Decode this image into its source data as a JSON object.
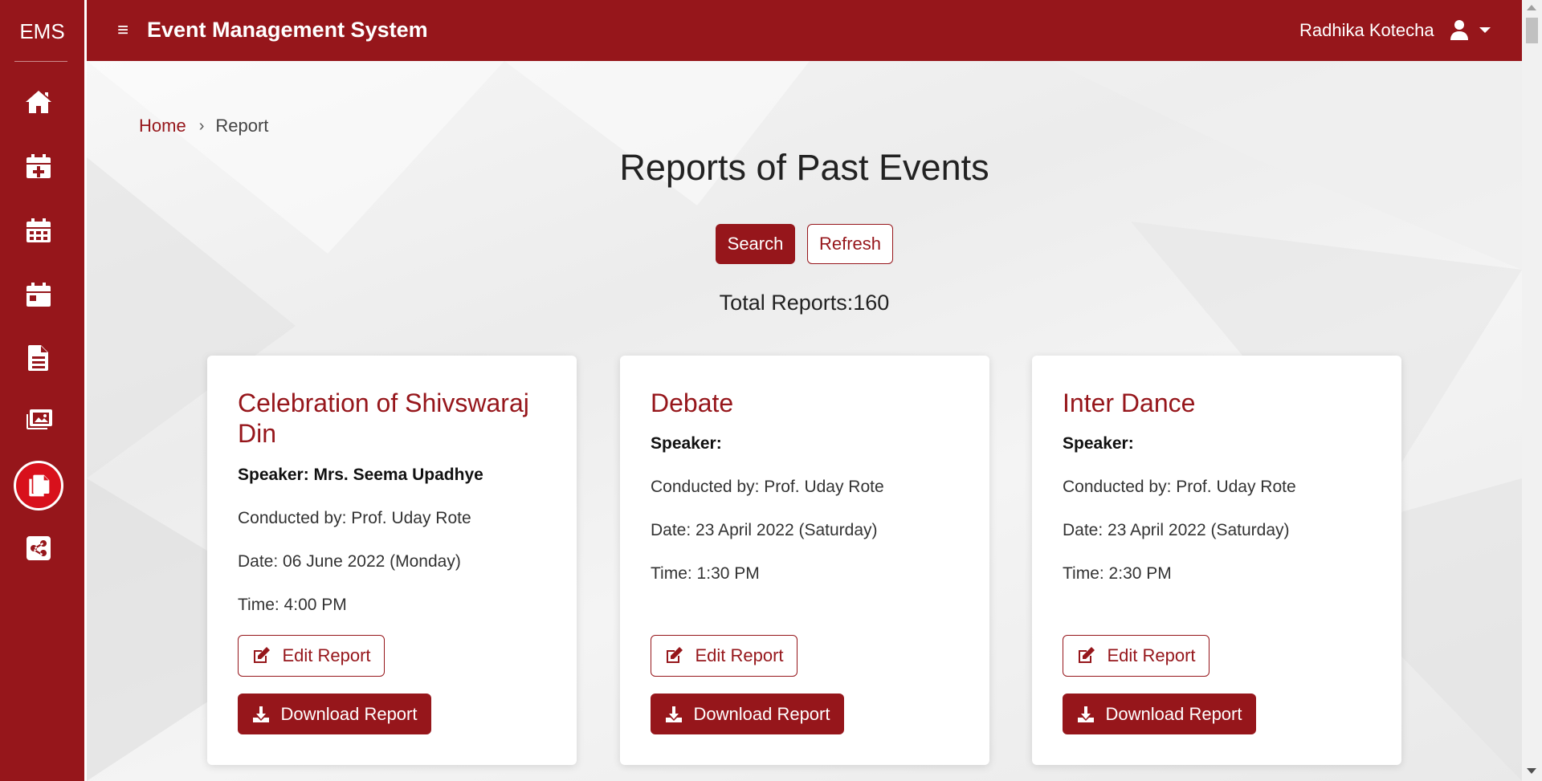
{
  "sidebar": {
    "brand": "EMS",
    "items": [
      {
        "icon": "home-icon"
      },
      {
        "icon": "calendar-plus-icon"
      },
      {
        "icon": "calendar-grid-icon"
      },
      {
        "icon": "calendar-day-icon"
      },
      {
        "icon": "document-icon"
      },
      {
        "icon": "images-icon"
      },
      {
        "icon": "copy-icon",
        "active": true
      },
      {
        "icon": "share-icon"
      }
    ]
  },
  "header": {
    "menu_icon": "≡",
    "title": "Event Management System",
    "user_name": "Radhika Kotecha"
  },
  "breadcrumb": {
    "home": "Home",
    "separator": "›",
    "current": "Report"
  },
  "page": {
    "title": "Reports of Past Events",
    "search_label": "Search",
    "refresh_label": "Refresh",
    "total_label": "Total Reports:",
    "total_count": "160"
  },
  "cards": [
    {
      "title": "Celebration of Shivswaraj Din",
      "speaker": "Speaker: Mrs. Seema Upadhye",
      "conducted_by": "Conducted by: Prof. Uday Rote",
      "date": "Date: 06 June 2022 (Monday)",
      "time": "Time: 4:00 PM",
      "edit_label": "Edit Report",
      "download_label": "Download Report"
    },
    {
      "title": "Debate",
      "speaker": "Speaker:",
      "conducted_by": "Conducted by: Prof. Uday Rote",
      "date": "Date: 23 April 2022 (Saturday)",
      "time": "Time: 1:30 PM",
      "edit_label": "Edit Report",
      "download_label": "Download Report"
    },
    {
      "title": "Inter Dance",
      "speaker": "Speaker:",
      "conducted_by": "Conducted by: Prof. Uday Rote",
      "date": "Date: 23 April 2022 (Saturday)",
      "time": "Time: 2:30 PM",
      "edit_label": "Edit Report",
      "download_label": "Download Report"
    }
  ],
  "colors": {
    "primary": "#96161b",
    "active_icon_bg": "#d8111c",
    "text": "#222222"
  }
}
